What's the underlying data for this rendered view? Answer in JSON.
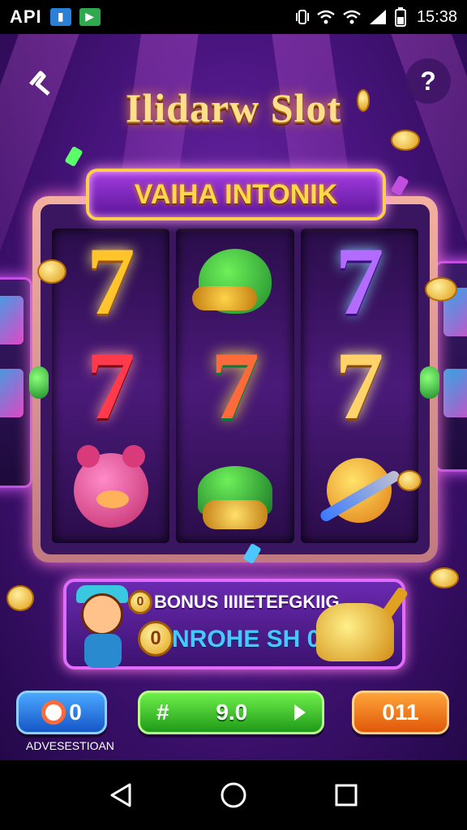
{
  "status_bar": {
    "left_label": "API",
    "time": "15:38"
  },
  "game": {
    "title": "Ilidarw Slot",
    "banner": "VAIHA INTONIK",
    "help_label": "?",
    "reels": [
      [
        "seven-gold",
        "frog-coins",
        "seven-purple"
      ],
      [
        "seven-red",
        "seven-rainbow",
        "seven-amber"
      ],
      [
        "pig-mascot",
        "helmet-coins",
        "orb-rod"
      ]
    ],
    "bonus": {
      "line1": "BONUS IIIIETEFGKIIG",
      "line2": "NROHE SH 03",
      "coin_mark_1": "0",
      "coin_mark_2": "0"
    },
    "buttons": {
      "blue_value": "0",
      "green_mark": "#",
      "green_value": "9.0",
      "orange_value": "011",
      "caption": "ADVESESTIOAN"
    }
  },
  "colors": {
    "background": "#4a1580",
    "accent_gold": "#ffd94a",
    "accent_pink": "#e26bff"
  }
}
